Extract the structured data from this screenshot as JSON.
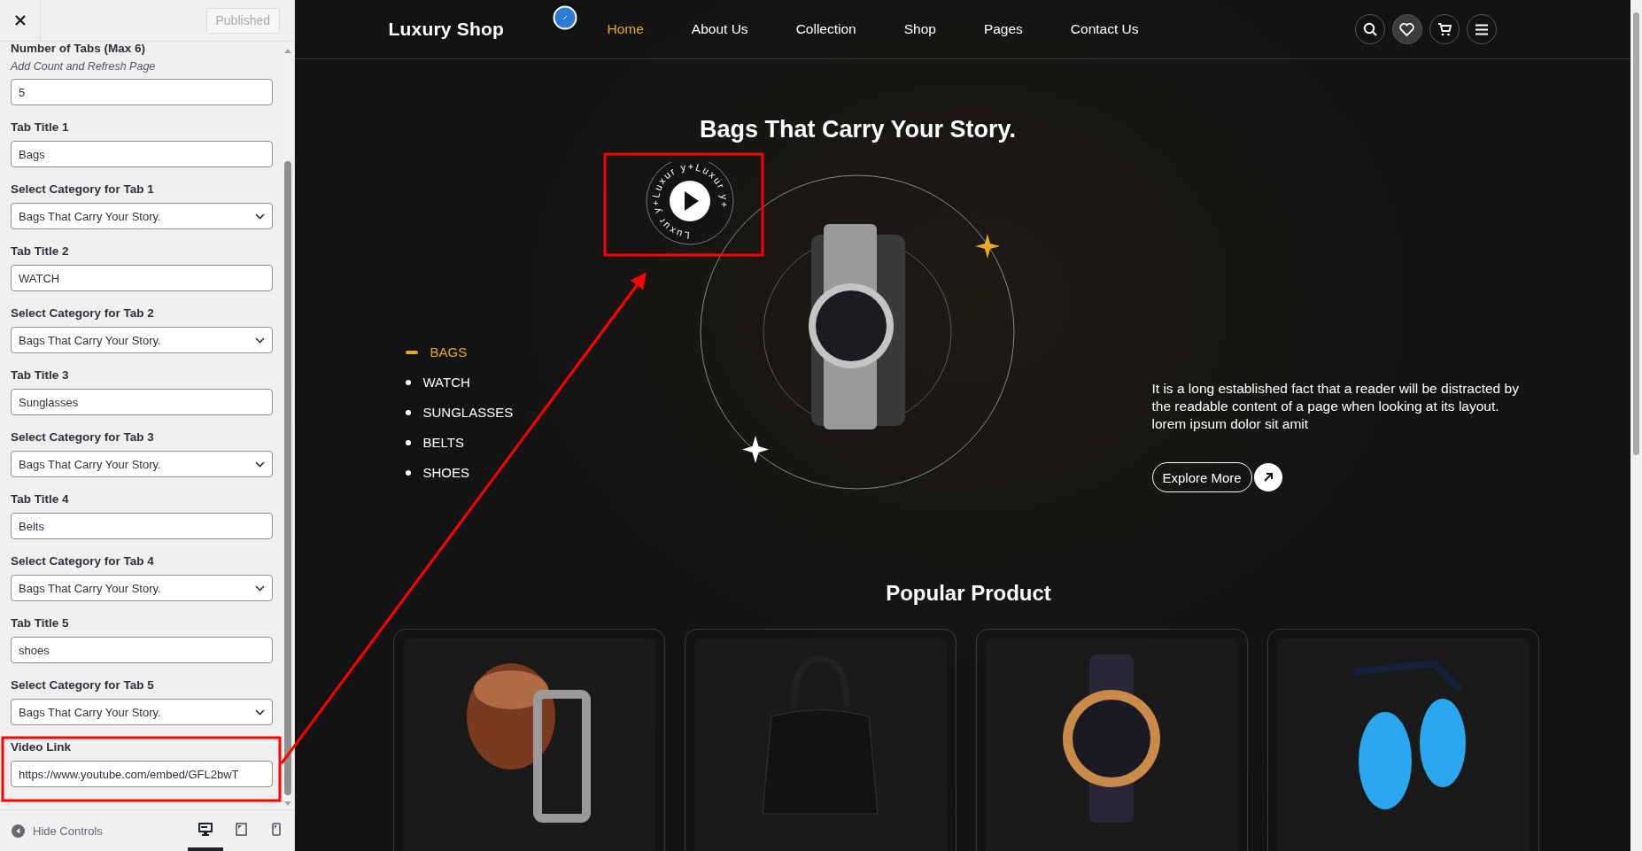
{
  "panel": {
    "publish_button": {
      "label": "Published",
      "disabled": true
    },
    "fields": [
      {
        "kind": "text",
        "label": "Number of Tabs (Max 6)",
        "description": "Add Count and Refresh Page",
        "value": "5"
      },
      {
        "kind": "text",
        "label": "Tab Title 1",
        "value": "Bags"
      },
      {
        "kind": "select",
        "label": "Select Category for Tab 1",
        "value": "Bags That Carry Your Story."
      },
      {
        "kind": "text",
        "label": "Tab Title 2",
        "value": "WATCH"
      },
      {
        "kind": "select",
        "label": "Select Category for Tab 2",
        "value": "Bags That Carry Your Story."
      },
      {
        "kind": "text",
        "label": "Tab Title 3",
        "value": "Sunglasses"
      },
      {
        "kind": "select",
        "label": "Select Category for Tab 3",
        "value": "Bags That Carry Your Story."
      },
      {
        "kind": "text",
        "label": "Tab Title 4",
        "value": "Belts"
      },
      {
        "kind": "select",
        "label": "Select Category for Tab 4",
        "value": "Bags That Carry Your Story."
      },
      {
        "kind": "text",
        "label": "Tab Title 5",
        "value": "shoes"
      },
      {
        "kind": "select",
        "label": "Select Category for Tab 5",
        "value": "Bags That Carry Your Story."
      },
      {
        "kind": "text",
        "label": "Video Link",
        "value": "https://www.youtube.com/embed/GFL2bwT"
      }
    ],
    "footer": {
      "hide_controls": "Hide Controls",
      "devices": [
        {
          "kind": "desktop",
          "selected": true
        },
        {
          "kind": "tablet",
          "selected": false
        },
        {
          "kind": "mobile",
          "selected": false
        }
      ]
    }
  },
  "site": {
    "logo": "Luxury Shop",
    "nav": [
      {
        "label": "Home",
        "selected": true
      },
      {
        "label": "About Us",
        "selected": false
      },
      {
        "label": "Collection",
        "selected": false
      },
      {
        "label": "Shop",
        "selected": false
      },
      {
        "label": "Pages",
        "selected": false
      },
      {
        "label": "Contact Us",
        "selected": false
      }
    ],
    "hero": {
      "title": "Bags That Carry Your Story.",
      "badge_text": "Luxur y+Luxur y+Luxur y+",
      "tabs": [
        {
          "label": "BAGS",
          "selected": true
        },
        {
          "label": "WATCH",
          "selected": false
        },
        {
          "label": "SUNGLASSES",
          "selected": false
        },
        {
          "label": "BELTS",
          "selected": false
        },
        {
          "label": "SHOES",
          "selected": false
        }
      ],
      "description": "It is a long established fact that a reader will be distracted by the readable content of a page when looking at its layout. lorem ipsum dolor sit amit",
      "button": "Explore More"
    },
    "popular": {
      "title": "Popular Product",
      "products": [
        {
          "kind": "photo"
        },
        {
          "kind": "photo"
        },
        {
          "kind": "photo"
        },
        {
          "kind": "photo"
        }
      ]
    }
  },
  "annotation_visible": true
}
